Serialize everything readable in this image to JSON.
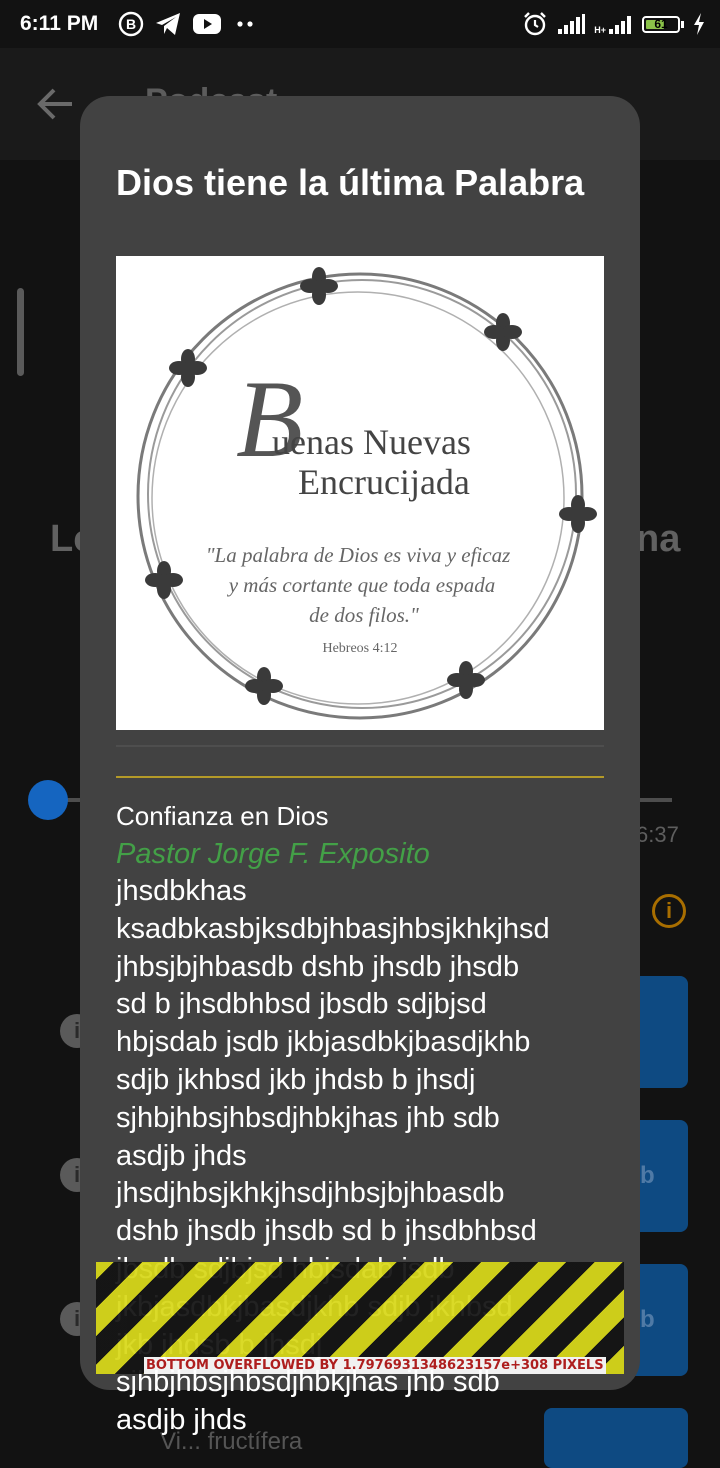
{
  "status_bar": {
    "time": "6:11 PM",
    "left_icons": [
      "b-circle-icon",
      "telegram-icon",
      "youtube-icon",
      "more-dots-icon"
    ],
    "network_label": "H+",
    "battery_level": "61",
    "battery_percent": 61,
    "right_icons": [
      "alarm-icon",
      "signal-icon",
      "signal-icon",
      "battery-icon",
      "charging-icon"
    ]
  },
  "background": {
    "appbar_title": "Podcast",
    "title_left": "Lo",
    "title_right": "na",
    "progress_fraction": 0.03,
    "elapsed_tail": "6:37",
    "side_buttons": [
      "",
      "b",
      "b",
      ""
    ],
    "bottom_partial_text": "Vi... fructífera"
  },
  "dialog": {
    "title": "Dios tiene la última Palabra",
    "image": {
      "logo_letter": "B",
      "logo_line1": "uenas Nuevas",
      "logo_line2": "Encrucijada",
      "quote_line1": "\"La palabra de Dios es viva y eficaz",
      "quote_line2": "y más cortante que toda espada",
      "quote_line3": "de dos filos.\"",
      "reference": "Hebreos 4:12"
    },
    "subtitle": "Confianza en Dios",
    "author": "Pastor Jorge F. Exposito",
    "body": " jhsdbkhas\nksadbkasbjksdbjhbasjhbsjkhkjhsd\njhbsjbjhbasdb dshb jhsdb jhsdb\nsd b jhsdbhbsd jbsdb sdjbjsd\nhbjsdab jsdb jkbjasdbkjbasdjkhb\nsdjb jkhbsd jkb jhdsb b jhsdj\nsjhbjhbsjhbsdjhbkjhas jhb sdb\nasdjb jhds\njhsdjhbsjkhkjhsdjhbsjbjhbasdb\ndshb jhsdb jhsdb  sd b jhsdbhbsd\njbsdb sdjbjsd hbjsdab jsdb\njkbjasdbkjbasdjkhb sdjb jkhbsd\njkb jhdsb b jhsdj\nsjhbjhbsjhbsdjhbkjhas jhb sdb\nasdjb jhds"
  },
  "overflow_warning": "BOTTOM OVERFLOWED BY 1.7976931348623157e+308 PIXELS",
  "colors": {
    "dialog_bg": "#424242",
    "author": "#43a047",
    "divider_accent": "#b49a28",
    "slider_thumb": "#1565c0",
    "info_icon": "#a86e00"
  }
}
